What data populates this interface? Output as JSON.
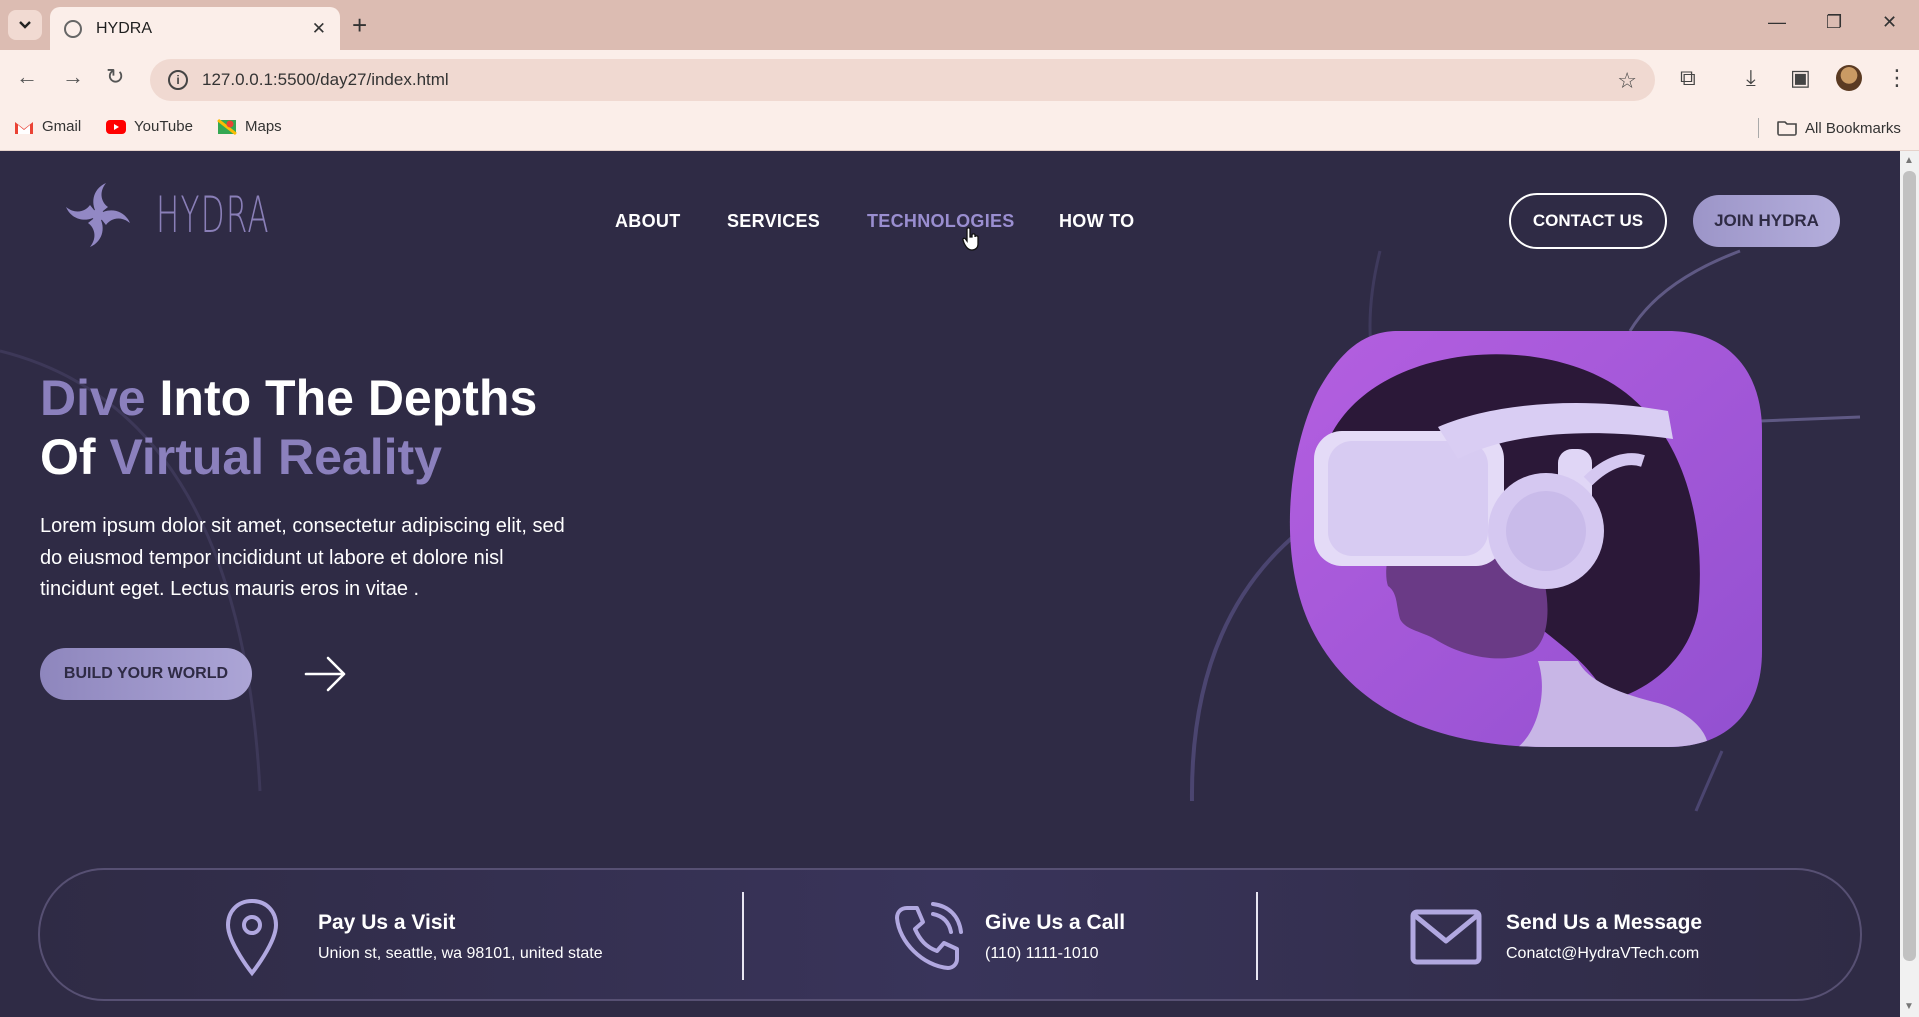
{
  "browser": {
    "tab_title": "HYDRA",
    "url": "127.0.0.1:5500/day27/index.html",
    "bookmarks": [
      {
        "label": "Gmail",
        "icon": "gmail-icon"
      },
      {
        "label": "YouTube",
        "icon": "youtube-icon"
      },
      {
        "label": "Maps",
        "icon": "maps-icon"
      }
    ],
    "all_bookmarks": "All Bookmarks"
  },
  "header": {
    "logo_text": "HYDRA",
    "nav": [
      "ABOUT",
      "SERVICES",
      "TECHNOLOGIES",
      "HOW TO"
    ],
    "active_nav": "TECHNOLOGIES",
    "contact_label": "CONTACT US",
    "join_label": "JOIN HYDRA"
  },
  "hero": {
    "title_line1_accent": "Dive",
    "title_line1_rest": " Into The Depths",
    "title_line2_start": "Of ",
    "title_line2_accent": "Virtual Reality",
    "body": "Lorem ipsum dolor sit amet, consectetur adipiscing elit, sed do eiusmod tempor incididunt ut labore et dolore nisl tincidunt eget. Lectus mauris eros in vitae .",
    "cta_label": "BUILD YOUR WORLD"
  },
  "contact": {
    "visit_title": "Pay Us a Visit",
    "visit_sub": "Union st, seattle, wa 98101, united state",
    "call_title": "Give Us a Call",
    "call_sub": "(110) 1111-1010",
    "message_title": "Send Us a Message",
    "message_sub": "Conatct@HydraVTech.com"
  },
  "colors": {
    "background": "#2f2b45",
    "accent": "#8b80bd",
    "button": "#aca5d6",
    "image_bg": "#a45ad6"
  }
}
